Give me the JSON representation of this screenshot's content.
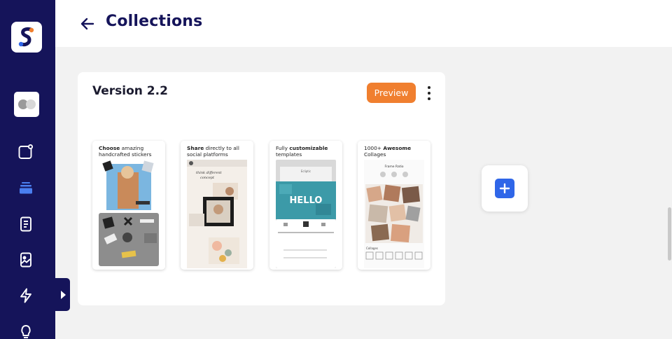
{
  "header": {
    "title": "Collections",
    "back_icon": "arrow-left-icon"
  },
  "sidebar": {
    "logo_icon": "brand-logo-icon",
    "items": [
      {
        "name": "nav-item-apps",
        "icon": "app-badge-icon",
        "active": false
      },
      {
        "name": "nav-item-collections",
        "icon": "stack-icon",
        "active": true
      },
      {
        "name": "nav-item-documents",
        "icon": "document-icon",
        "active": false
      },
      {
        "name": "nav-item-images",
        "icon": "image-icon",
        "active": false
      },
      {
        "name": "nav-item-automations",
        "icon": "lightning-icon",
        "active": false
      },
      {
        "name": "nav-item-ideas",
        "icon": "lightbulb-icon",
        "active": false
      }
    ],
    "expand_icon": "caret-right-icon"
  },
  "card": {
    "title": "Version 2.2",
    "preview_label": "Preview",
    "more_icon": "more-vertical-icon",
    "screenshots": [
      {
        "caption_bold": "Choose",
        "caption_rest": " amazing handcrafted stickers",
        "mock_text": []
      },
      {
        "caption_bold": "Share",
        "caption_rest": " directly to all social platforms",
        "mock_text": [
          "think different",
          "concept"
        ]
      },
      {
        "caption_pre": "Fully ",
        "caption_bold": "customizable",
        "caption_rest": " templates",
        "mock_text": [
          "Ecliptic",
          "HELLO"
        ]
      },
      {
        "caption_pre": "1000+ ",
        "caption_bold": "Awesome",
        "caption_rest": " Collages",
        "mock_text": [
          "Frame Ratio",
          "Collages"
        ]
      }
    ]
  },
  "add_button": {
    "icon": "plus-icon"
  },
  "colors": {
    "sidebar": "#15145a",
    "accent": "#f07f2f",
    "primary": "#2f66e8",
    "title": "#15145a"
  }
}
